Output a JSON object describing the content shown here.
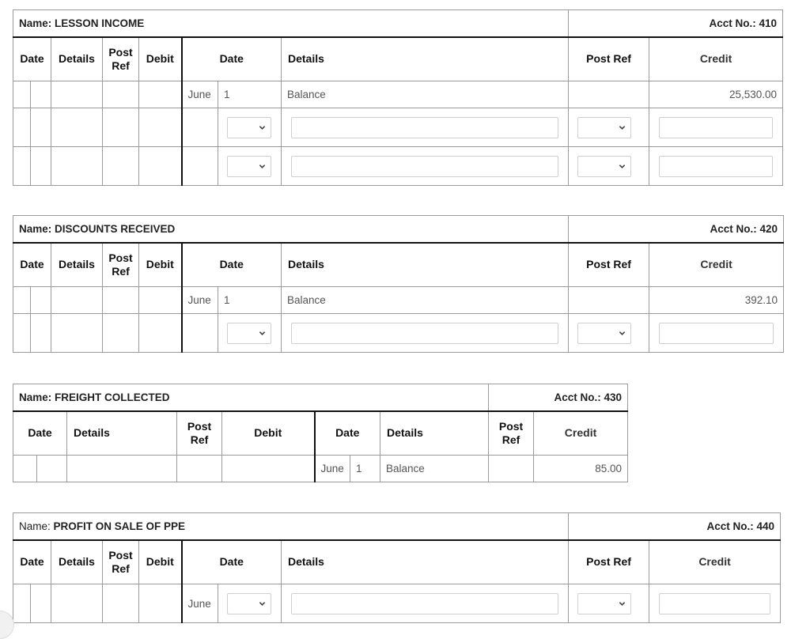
{
  "ledgers": [
    {
      "name_label": "Name:",
      "name": "LESSON INCOME",
      "acct_label": "Acct No.:",
      "acct_no": "410",
      "headers": {
        "debit_date": "Date",
        "debit_details": "Details",
        "debit_post_ref": "Post Ref",
        "debit": "Debit",
        "credit_date": "Date",
        "credit_details": "Details",
        "credit_post_ref": "Post Ref",
        "credit": "Credit"
      },
      "entries": [
        {
          "month": "June",
          "day": "1",
          "details": "Balance",
          "post_ref": "",
          "credit": "25,530.00"
        }
      ],
      "input_rows": 2
    },
    {
      "name_label": "Name:",
      "name": "DISCOUNTS RECEIVED",
      "acct_label": "Acct No.:",
      "acct_no": "420",
      "headers": {
        "debit_date": "Date",
        "debit_details": "Details",
        "debit_post_ref": "Post Ref",
        "debit": "Debit",
        "credit_date": "Date",
        "credit_details": "Details",
        "credit_post_ref": "Post Ref",
        "credit": "Credit"
      },
      "entries": [
        {
          "month": "June",
          "day": "1",
          "details": "Balance",
          "post_ref": "",
          "credit": "392.10"
        }
      ],
      "input_rows": 1
    },
    {
      "name_label": "Name:",
      "name": "FREIGHT COLLECTED",
      "acct_label": "Acct No.:",
      "acct_no": "430",
      "headers": {
        "debit_date": "Date",
        "debit_details": "Details",
        "debit_post_ref": "Post Ref",
        "debit": "Debit",
        "credit_date": "Date",
        "credit_details": "Details",
        "credit_post_ref": "Post Ref",
        "credit": "Credit"
      },
      "entries": [
        {
          "month": "June",
          "day": "1",
          "details": "Balance",
          "post_ref": "",
          "credit": "85.00"
        }
      ],
      "input_rows": 0
    },
    {
      "name_label": "Name:",
      "name": "PROFIT ON SALE OF PPE",
      "acct_label": "Acct No.:",
      "acct_no": "440",
      "headers": {
        "debit_date": "Date",
        "debit_details": "Details",
        "debit_post_ref": "Post Ref",
        "debit": "Debit",
        "credit_date": "Date",
        "credit_details": "Details",
        "credit_post_ref": "Post Ref",
        "credit": "Credit"
      },
      "entries": [],
      "input_rows": 1,
      "input_row_month": "June"
    }
  ],
  "inputs": {
    "date_select_value": "",
    "details_value": "",
    "post_ref_select_value": "",
    "credit_value": ""
  },
  "help_icon": "help-icon"
}
